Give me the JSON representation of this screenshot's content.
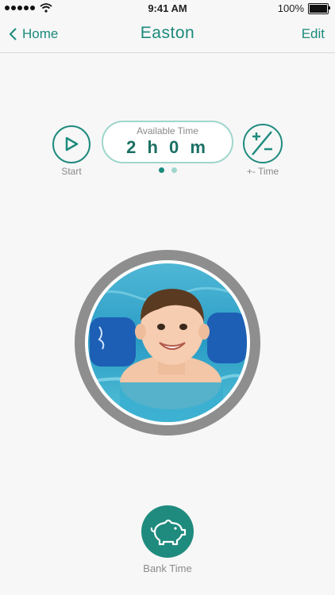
{
  "status_bar": {
    "time": "9:41 AM",
    "battery": "100%",
    "icons": [
      "signal-dots-icon",
      "wifi-icon",
      "battery-icon"
    ]
  },
  "nav": {
    "back_label": "Home",
    "title": "Easton",
    "edit_label": "Edit"
  },
  "controls": {
    "start_label": "Start",
    "adjust_label": "+- Time",
    "available_label": "Available Time",
    "available_value": "2 h 0 m"
  },
  "pager": {
    "pages": 2,
    "current": 1
  },
  "bank": {
    "label": "Bank Time",
    "icon": "piggy-bank-icon"
  },
  "colors": {
    "accent": "#1b8a7c",
    "accent_light": "#9fd6cd",
    "ring": "#8e8e8e",
    "background": "#f7f7f7"
  }
}
